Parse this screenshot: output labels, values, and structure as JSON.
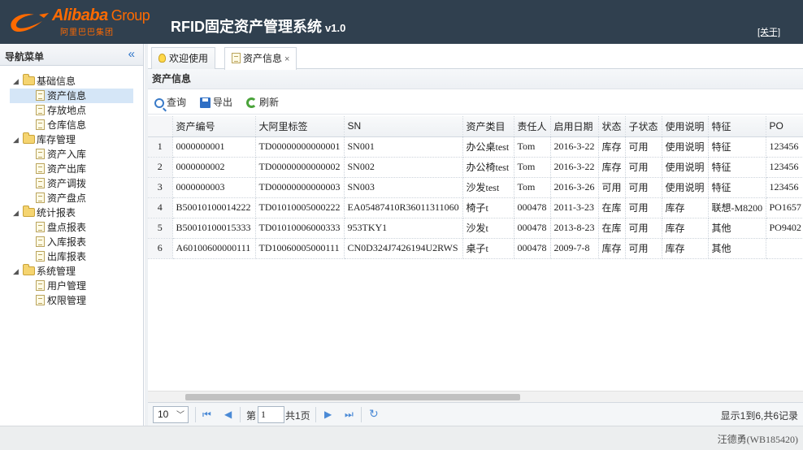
{
  "header": {
    "logo_word": "Alibaba",
    "logo_group": "Group",
    "logo_cn": "阿里巴巴集团",
    "title": "RFID固定资产管理系统",
    "version": "v1.0",
    "about_label": "[关于]"
  },
  "sidebar": {
    "title": "导航菜单",
    "collapse_icon": "«",
    "groups": [
      {
        "label": "基础信息",
        "items": [
          "资产信息",
          "存放地点",
          "仓库信息"
        ]
      },
      {
        "label": "库存管理",
        "items": [
          "资产入库",
          "资产出库",
          "资产调拨",
          "资产盘点"
        ]
      },
      {
        "label": "统计报表",
        "items": [
          "盘点报表",
          "入库报表",
          "出库报表"
        ]
      },
      {
        "label": "系统管理",
        "items": [
          "用户管理",
          "权限管理"
        ]
      }
    ],
    "selected_item": "资产信息"
  },
  "tabs": [
    {
      "label": "欢迎使用",
      "icon": "bulb-icon"
    },
    {
      "label": "资产信息",
      "icon": "doc-icon",
      "close": "×"
    }
  ],
  "panel": {
    "title": "资产信息",
    "toolbar": {
      "query_label": "查询",
      "export_label": "导出",
      "refresh_label": "刷新"
    }
  },
  "grid": {
    "columns": [
      "资产编号",
      "大阿里标签",
      "SN",
      "资产类目",
      "责任人",
      "启用日期",
      "状态",
      "子状态",
      "使用说明",
      "特征",
      "PO"
    ],
    "rows": [
      [
        "1",
        "0000000001",
        "TD00000000000001",
        "SN001",
        "办公桌test",
        "Tom",
        "2016-3-22",
        "库存",
        "可用",
        "使用说明",
        "特征",
        "123456"
      ],
      [
        "2",
        "0000000002",
        "TD00000000000002",
        "SN002",
        "办公椅test",
        "Tom",
        "2016-3-22",
        "库存",
        "可用",
        "使用说明",
        "特征",
        "123456"
      ],
      [
        "3",
        "0000000003",
        "TD00000000000003",
        "SN003",
        "沙发test",
        "Tom",
        "2016-3-26",
        "可用",
        "可用",
        "使用说明",
        "特征",
        "123456"
      ],
      [
        "4",
        "B50010100014222",
        "TD01010005000222",
        "EA05487410R36011311060",
        "椅子t",
        "000478",
        "2011-3-23",
        "在库",
        "可用",
        "库存",
        "联想-M8200",
        "PO1657"
      ],
      [
        "5",
        "B50010100015333",
        "TD01010006000333",
        "953TKY1",
        "沙发t",
        "000478",
        "2013-8-23",
        "在库",
        "可用",
        "库存",
        "其他",
        "PO9402"
      ],
      [
        "6",
        "A60100600000111",
        "TD10060005000111",
        "CN0D324J7426194U2RWS",
        "桌子t",
        "000478",
        "2009-7-8",
        "库存",
        "可用",
        "库存",
        "其他",
        ""
      ]
    ]
  },
  "pager": {
    "page_size": "10",
    "page_prefix": "第",
    "page_value": "1",
    "page_total": "共1页",
    "info": "显示1到6,共6记录"
  },
  "footer": {
    "user": "汪德勇(WB185420)"
  },
  "colors": {
    "header_bg": "#30404f",
    "brand_orange": "#ff6a00",
    "selection": "#d5e6f7"
  }
}
